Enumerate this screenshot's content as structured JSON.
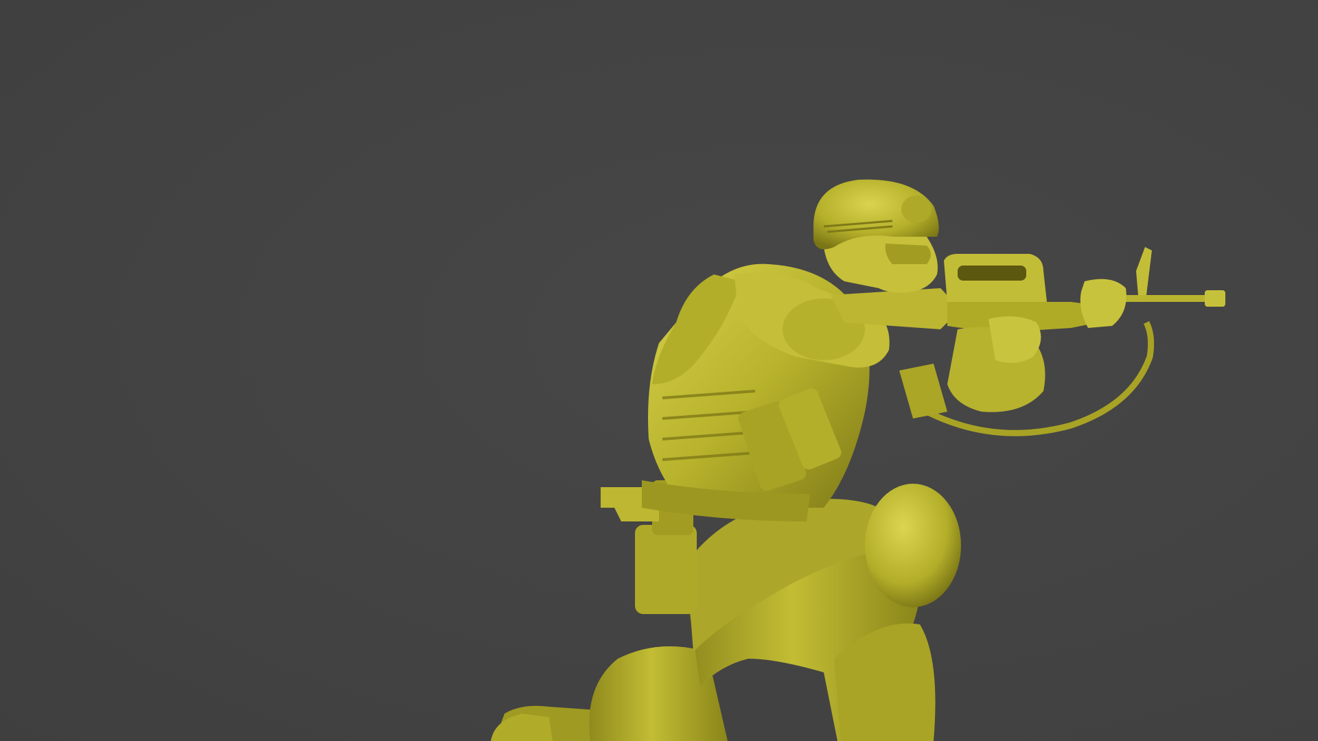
{
  "scene": {
    "subject_icon": "kneeling-soldier-3d-model",
    "colors": {
      "background": "#434343",
      "model_base": "#b8b32c",
      "model_light": "#d6d04a",
      "model_shadow": "#7f7a17",
      "model_dark": "#5c5810"
    }
  }
}
